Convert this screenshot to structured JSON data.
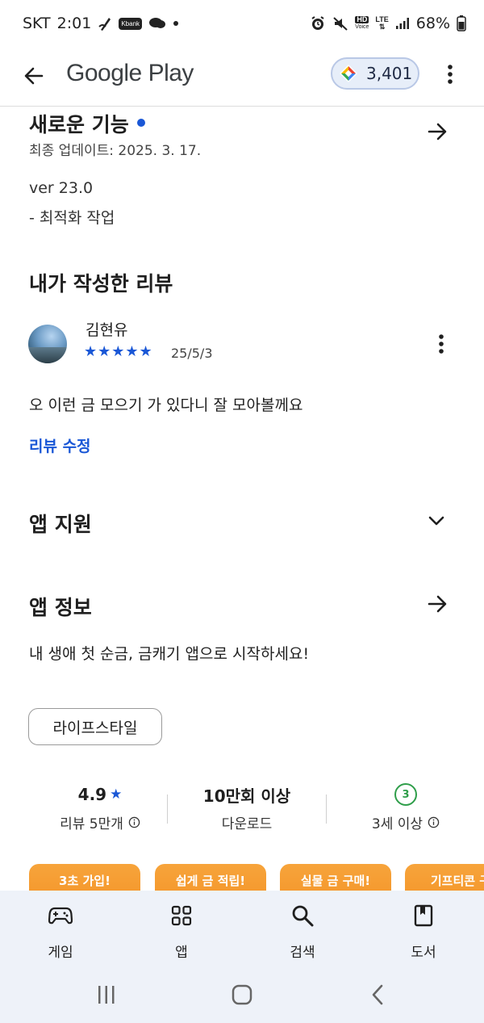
{
  "status_bar": {
    "carrier": "SKT",
    "time": "2:01",
    "kbank_label": "Kbank",
    "hd_label": "HD",
    "voice_label": "Voice",
    "lte_label": "LTE",
    "battery": "68%"
  },
  "app_bar": {
    "title": "Google Play",
    "points": "3,401"
  },
  "whats_new": {
    "title": "새로운 기능",
    "last_updated": "최종 업데이트: 2025. 3. 17.",
    "version": "ver 23.0",
    "note": "- 최적화 작업"
  },
  "my_review": {
    "title": "내가 작성한 리뷰",
    "reviewer": "김현유",
    "stars": "★★★★★",
    "rating": 5,
    "date": "25/5/3",
    "text": "오 이런 금 모으기 가 있다니 잘 모아볼께요",
    "edit_label": "리뷰 수정"
  },
  "app_support": {
    "title": "앱 지원"
  },
  "about": {
    "title": "앱 정보",
    "description": "내 생애 첫 순금, 금캐기 앱으로 시작하세요!",
    "category": "라이프스타일"
  },
  "stats": {
    "rating_value": "4.9",
    "rating_star": "★",
    "reviews_label": "리뷰 5만개",
    "downloads_value": "10만회 이상",
    "downloads_label": "다운로드",
    "age_badge": "3",
    "age_label": "3세 이상"
  },
  "screenshots": [
    "3초 가입!",
    "쉽게 금 적립!",
    "실물 금 구매!",
    "기프티콘 구"
  ],
  "bottom_nav": {
    "games": "게임",
    "apps": "앱",
    "search": "검색",
    "books": "도서"
  },
  "colors": {
    "accent": "#1a57d6",
    "age_green": "#2f9e4a",
    "thumb_orange": "#f39226",
    "nav_bg": "#eef2f9"
  }
}
